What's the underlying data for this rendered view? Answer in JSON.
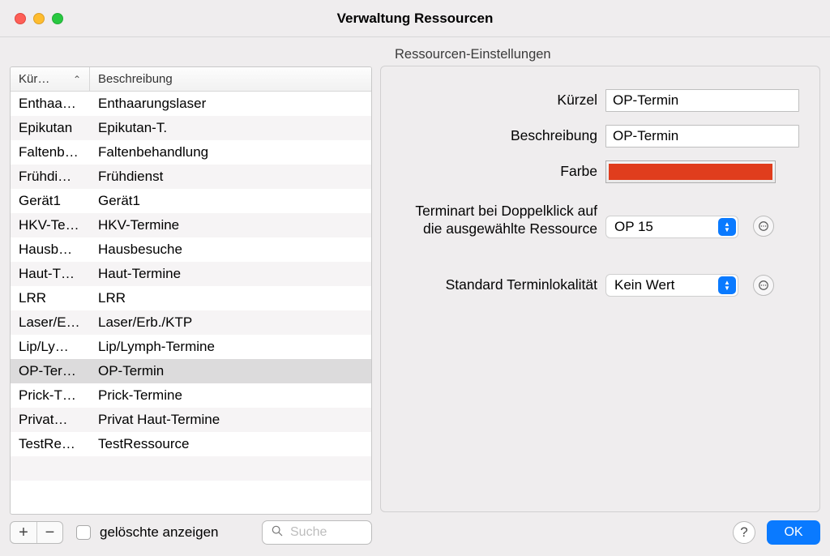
{
  "window": {
    "title": "Verwaltung Ressourcen"
  },
  "table": {
    "headers": {
      "col1": "Kür…",
      "col2": "Beschreibung"
    },
    "rows": [
      {
        "short": "Enthaa…",
        "desc": "Enthaarungslaser"
      },
      {
        "short": "Epikutan",
        "desc": "Epikutan-T."
      },
      {
        "short": "Faltenb…",
        "desc": "Faltenbehandlung"
      },
      {
        "short": "Frühdi…",
        "desc": "Frühdienst"
      },
      {
        "short": "Gerät1",
        "desc": "Gerät1"
      },
      {
        "short": "HKV-Te…",
        "desc": "HKV-Termine"
      },
      {
        "short": "Hausb…",
        "desc": "Hausbesuche"
      },
      {
        "short": "Haut-T…",
        "desc": "Haut-Termine"
      },
      {
        "short": "LRR",
        "desc": "LRR"
      },
      {
        "short": "Laser/E…",
        "desc": "Laser/Erb./KTP"
      },
      {
        "short": "Lip/Ly…",
        "desc": "Lip/Lymph-Termine"
      },
      {
        "short": "OP-Ter…",
        "desc": "OP-Termin"
      },
      {
        "short": "Prick-T…",
        "desc": "Prick-Termine"
      },
      {
        "short": "Privat…",
        "desc": "Privat Haut-Termine"
      },
      {
        "short": "TestRe…",
        "desc": "TestRessource"
      }
    ],
    "selected_index": 11
  },
  "footer": {
    "show_deleted_label": "gelöschte anzeigen",
    "search_placeholder": "Suche"
  },
  "settings": {
    "panel_title": "Ressourcen-Einstellungen",
    "labels": {
      "kuerzel": "Kürzel",
      "beschreibung": "Beschreibung",
      "farbe": "Farbe",
      "terminart": "Terminart bei Doppelklick auf die ausgewählte Ressource",
      "lokalitaet": "Standard Terminlokalität"
    },
    "values": {
      "kuerzel": "OP-Termin",
      "beschreibung": "OP-Termin",
      "farbe_hex": "#e03d1d",
      "terminart": "OP 15",
      "lokalitaet": "Kein Wert"
    }
  },
  "buttons": {
    "ok": "OK",
    "help": "?",
    "ellipsis": "⊙"
  }
}
